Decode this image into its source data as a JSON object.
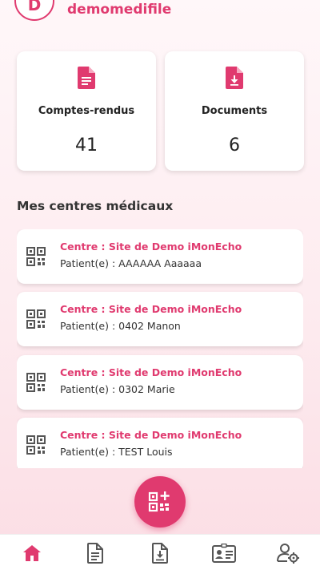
{
  "header": {
    "avatar_initial": "D",
    "username": "demomedifile"
  },
  "stats": [
    {
      "label": "Comptes-rendus",
      "value": "41",
      "icon": "report-icon"
    },
    {
      "label": "Documents",
      "value": "6",
      "icon": "download-document-icon"
    }
  ],
  "section": {
    "title": "Mes centres médicaux"
  },
  "centers": [
    {
      "center": "Centre : Site de Demo iMonEcho",
      "patient": "Patient(e) : AAAAAA Aaaaaa"
    },
    {
      "center": "Centre : Site de Demo iMonEcho",
      "patient": "Patient(e) : 0402 Manon"
    },
    {
      "center": "Centre : Site de Demo iMonEcho",
      "patient": "Patient(e) : 0302 Marie"
    },
    {
      "center": "Centre : Site de Demo iMonEcho",
      "patient": "Patient(e) : TEST Louis"
    }
  ],
  "fab": {
    "icon": "qr-add-icon"
  },
  "bottom_nav": [
    {
      "icon": "home-icon",
      "active": true
    },
    {
      "icon": "document-icon",
      "active": false
    },
    {
      "icon": "download-document-icon",
      "active": false
    },
    {
      "icon": "id-card-icon",
      "active": false
    },
    {
      "icon": "user-settings-icon",
      "active": false
    }
  ],
  "colors": {
    "accent": "#e03a6f",
    "nav_inactive": "#555555"
  }
}
